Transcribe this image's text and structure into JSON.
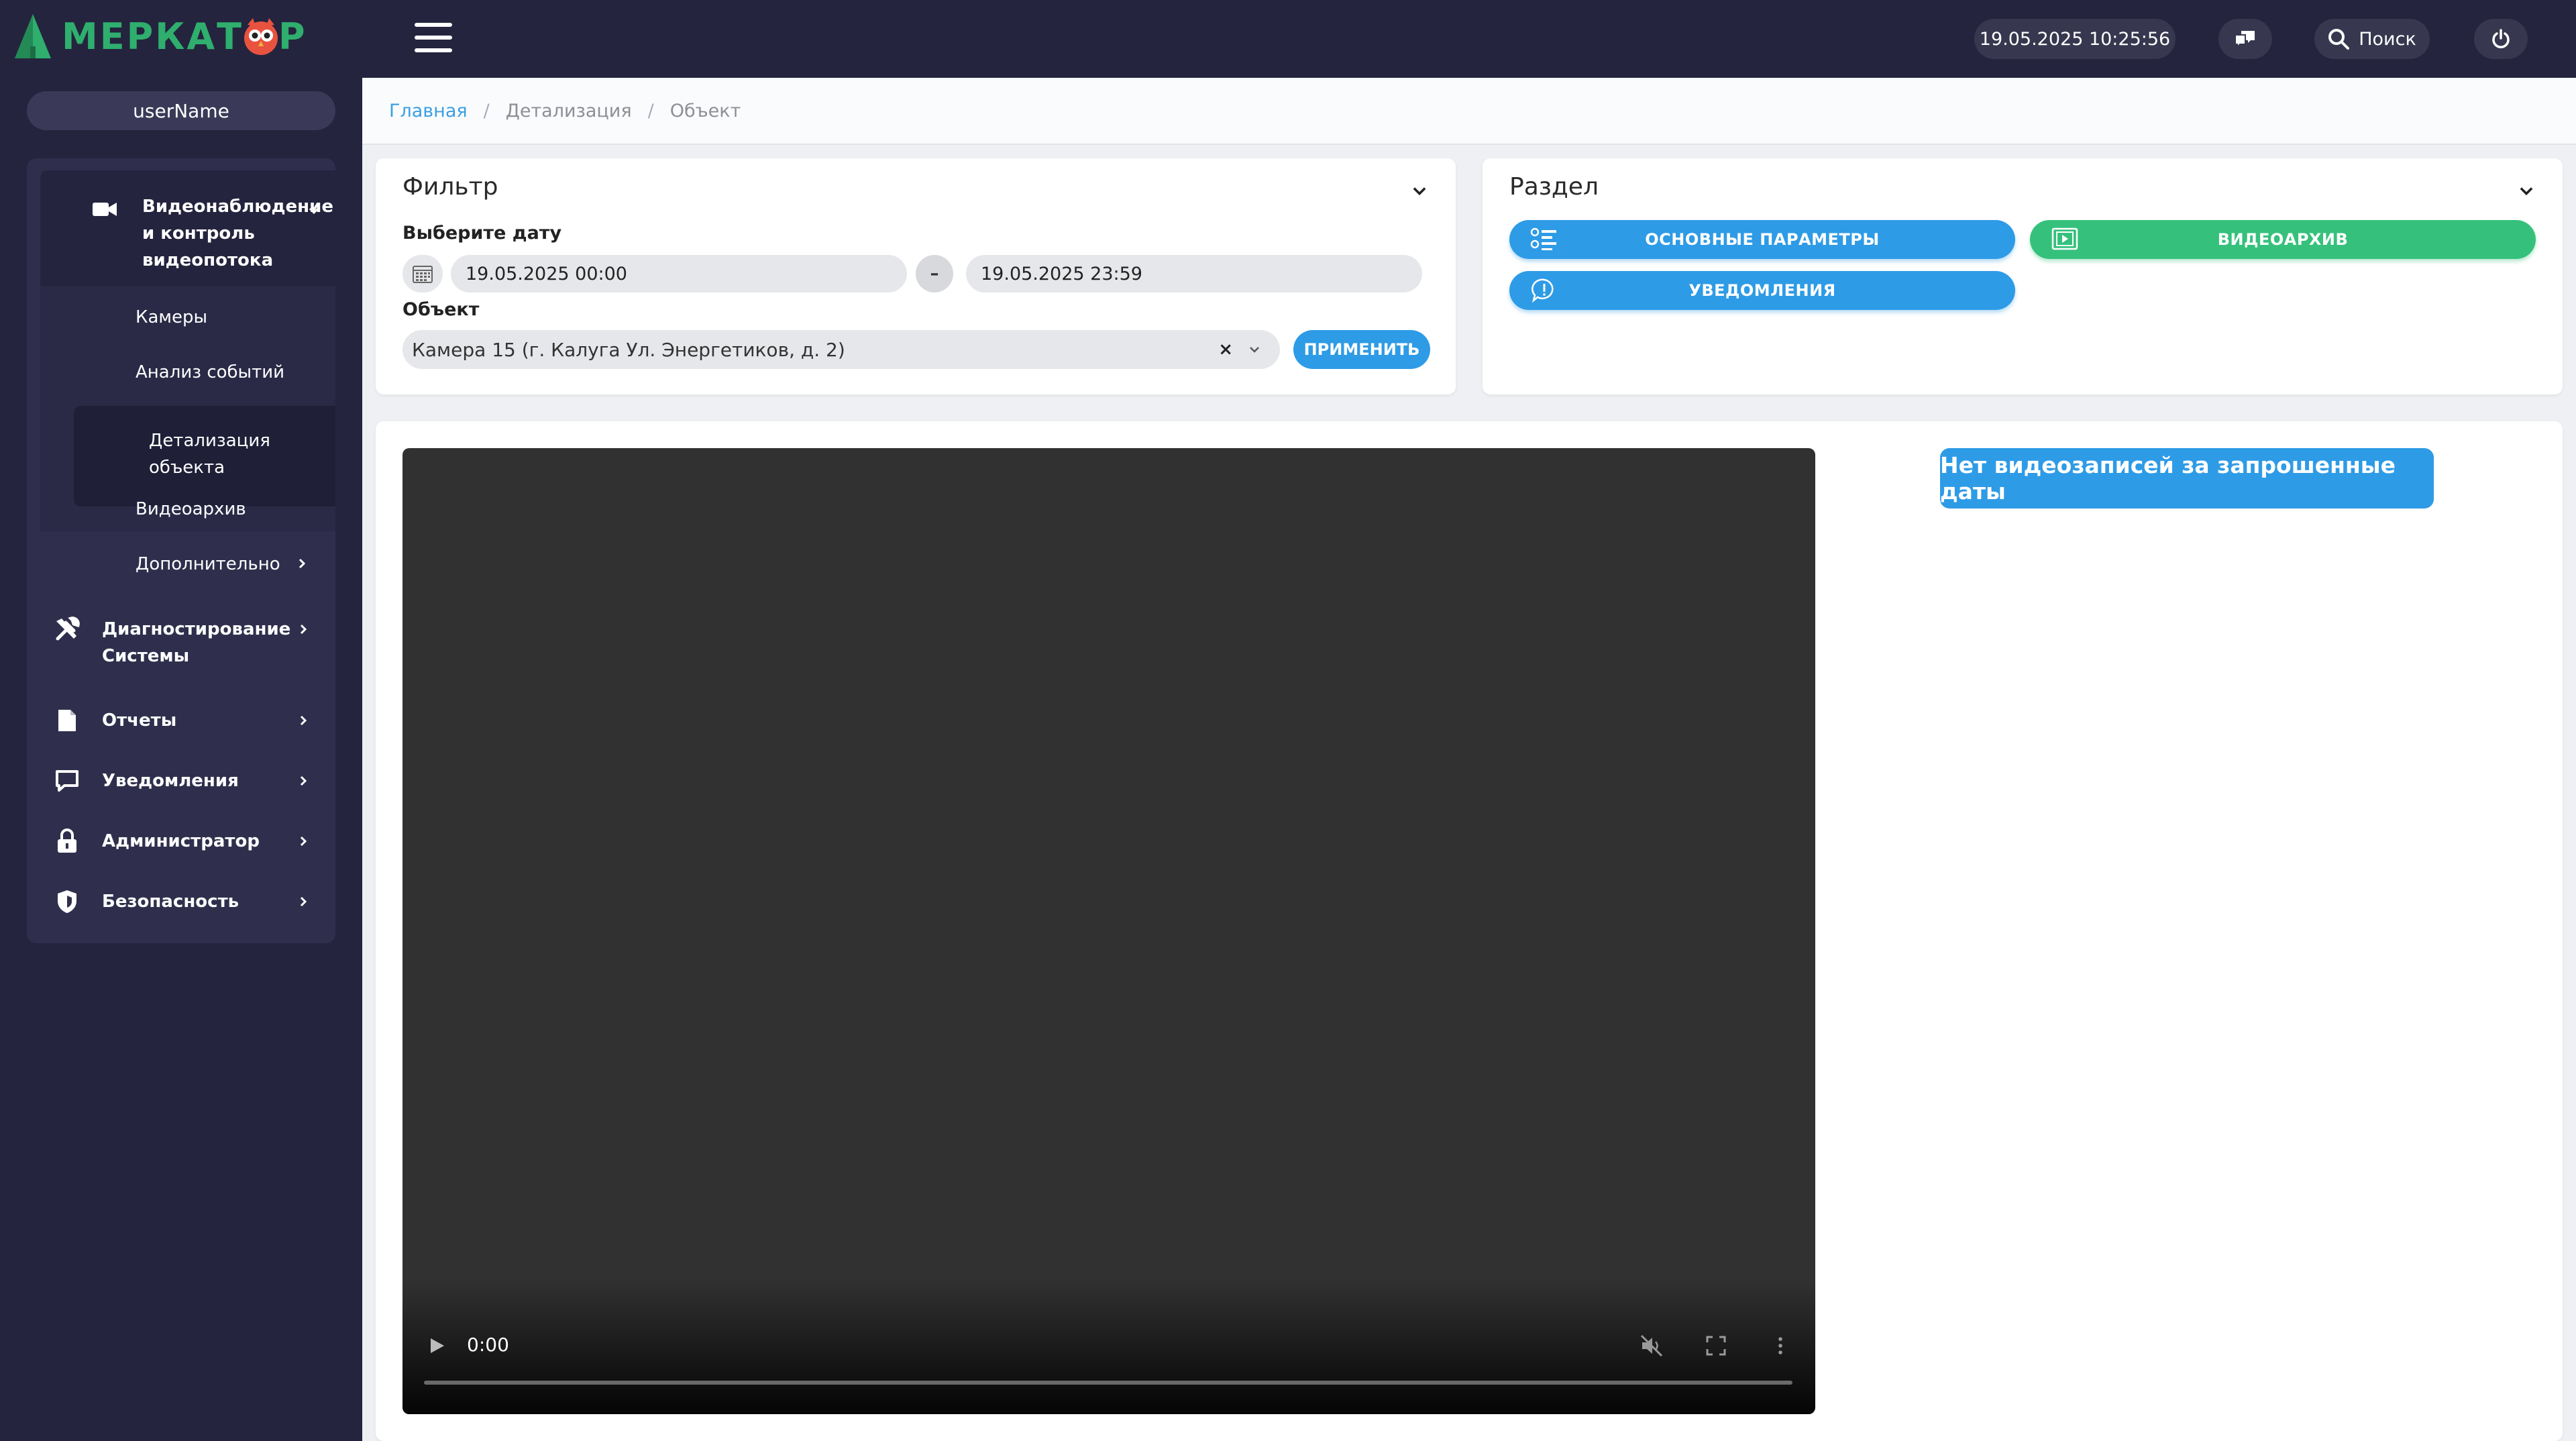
{
  "app": {
    "logo_text_left": "МЕРКАТ",
    "logo_text_right": "Р",
    "brand_color": "#2fae6e"
  },
  "sidebar": {
    "user": "userName",
    "menu": [
      {
        "label": "Видеонаблюдение и контроль видеопотока",
        "icon": "video-camera-icon",
        "expanded": true
      },
      {
        "label": "Диагностирование Системы",
        "icon": "tools-icon"
      },
      {
        "label": "Отчеты",
        "icon": "document-icon"
      },
      {
        "label": "Уведомления",
        "icon": "chat-icon"
      },
      {
        "label": "Администратор",
        "icon": "lock-icon"
      },
      {
        "label": "Безопасность",
        "icon": "shield-icon"
      }
    ],
    "submenu": [
      {
        "label": "Камеры"
      },
      {
        "label": "Анализ событий"
      },
      {
        "label": "Детализация объекта",
        "active": true
      },
      {
        "label": "Видеоархив"
      },
      {
        "label": "Дополнительно"
      }
    ]
  },
  "topbar": {
    "datetime": "19.05.2025 10:25:56",
    "search_label": "Поиск"
  },
  "breadcrumb": [
    "Главная",
    "Детализация",
    "Объект"
  ],
  "filter": {
    "title": "Фильтр",
    "date_label": "Выберите дату",
    "date_from": "19.05.2025 00:00",
    "date_separator": "–",
    "date_to": "19.05.2025 23:59",
    "object_label": "Объект",
    "object_value": "Камера 15 (г. Калуга Ул. Энергетиков, д. 2)",
    "clear_glyph": "×",
    "apply_label": "ПРИМЕНИТЬ"
  },
  "section": {
    "title": "Раздел",
    "buttons": [
      {
        "label": "ОСНОВНЫЕ ПАРАМЕТРЫ",
        "color": "#2e9be6"
      },
      {
        "label": "ВИДЕОАРХИВ",
        "color": "#35c17c"
      },
      {
        "label": "УВЕДОМЛЕНИЯ",
        "color": "#2e9be6"
      }
    ]
  },
  "video": {
    "time": "0:00",
    "progress_fraction": 0
  },
  "message": {
    "no_records": "Нет видеозаписей за запрошенные даты"
  }
}
